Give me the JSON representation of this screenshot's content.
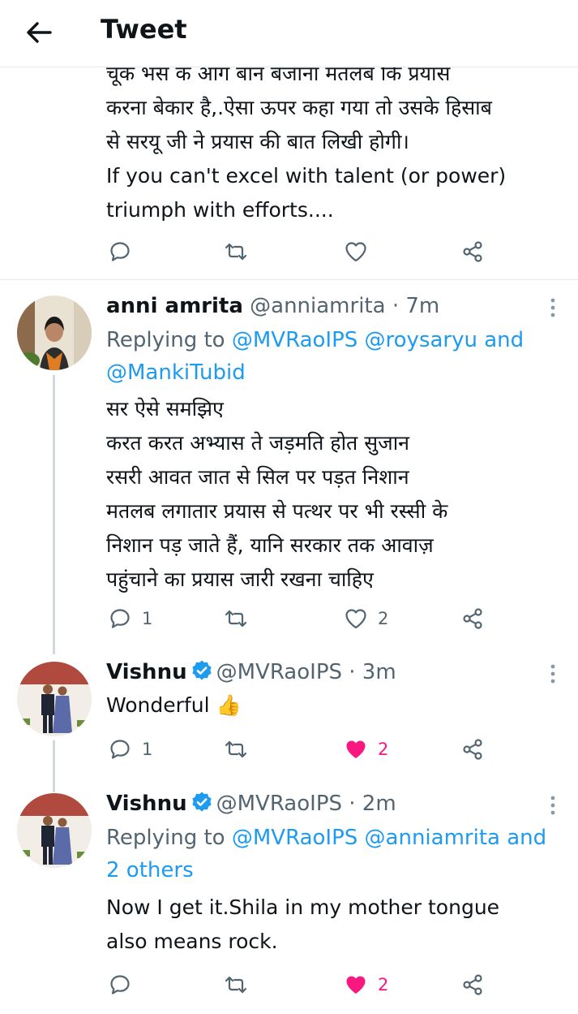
{
  "header": {
    "title": "Tweet"
  },
  "top_tweet": {
    "text": "चूक भस क आग बान बजाना मतलब कि प्रयास\nकरना बेकार है,.ऐसा ऊपर कहा गया तो उसके हिसाब\nसे सरयू जी ने प्रयास की बात लिखी होगी।\nIf you can't excel with talent (or power)\ntriumph with efforts...."
  },
  "replies": [
    {
      "name": "anni amrita",
      "handle": "@anniamrita",
      "time": "7m",
      "replying_prefix": "Replying to",
      "replying_mentions": [
        "@MVRaoIPS",
        "@roysaryu"
      ],
      "replying_and": "and",
      "replying_last": "@MankiTubid",
      "text": "सर ऐसे समझिए\nकरत करत अभ्यास ते जड़मति होत सुजान\nरसरी आवत जात से सिल पर पड़त निशान\nमतलब लगातार प्रयास से पत्थर पर भी रस्सी के\nनिशान पड़ जाते हैं, यानि सरकार तक आवाज़\nपहुंचाने का प्रयास जारी रखना चाहिए",
      "reply_count": "1",
      "like_count": "2"
    },
    {
      "name": "Vishnu",
      "handle": "@MVRaoIPS",
      "time": "3m",
      "text": "Wonderful",
      "emoji": "👍",
      "reply_count": "1",
      "like_count": "2"
    },
    {
      "name": "Vishnu",
      "handle": "@MVRaoIPS",
      "time": "2m",
      "replying_prefix": "Replying to",
      "replying_mentions": [
        "@MVRaoIPS",
        "@anniamrita"
      ],
      "replying_and_others": "and 2 others",
      "text": "Now I get it.Shila in my mother tongue\nalso means rock.",
      "like_count": "2"
    }
  ],
  "icons": {
    "back": "arrow-left-icon",
    "reply": "comment-icon",
    "retweet": "retweet-icon",
    "like": "heart-icon",
    "share": "share-icon",
    "verified": "verified-badge-icon",
    "more": "more-vertical-icon"
  },
  "colors": {
    "link": "#1d9bf0",
    "like_active": "#f91880",
    "secondary_text": "#536471",
    "icon_gray": "#536471",
    "verified": "#1d9bf0"
  }
}
